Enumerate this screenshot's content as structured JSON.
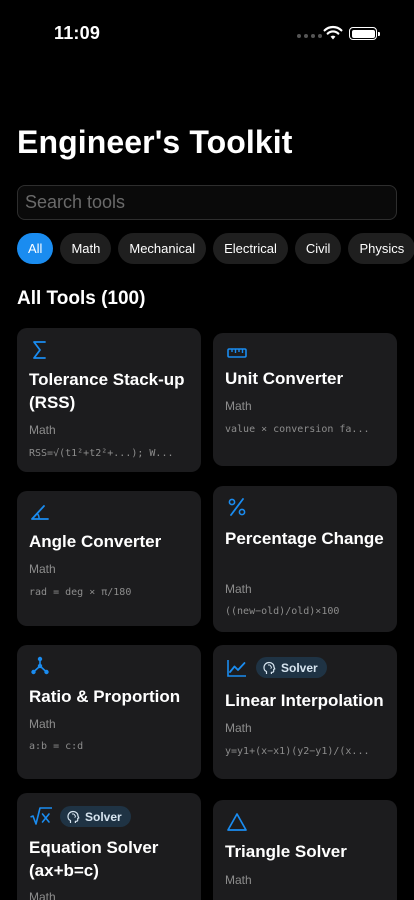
{
  "status_bar": {
    "time": "11:09"
  },
  "header": {
    "title": "Engineer's Toolkit"
  },
  "search": {
    "placeholder": "Search tools"
  },
  "filters": [
    "All",
    "Math",
    "Mechanical",
    "Electrical",
    "Civil",
    "Physics"
  ],
  "active_filter": "All",
  "section": {
    "title": "All Tools (100)"
  },
  "tools": [
    {
      "icon": "sigma-icon",
      "title": "Tolerance Stack-up (RSS)",
      "category": "Math",
      "formula": "RSS=√(t1²+t2²+...); W..."
    },
    {
      "icon": "ruler-icon",
      "title": "Unit Converter",
      "category": "Math",
      "formula": "value × conversion fa..."
    },
    {
      "icon": "angle-icon",
      "title": "Angle Converter",
      "category": "Math",
      "formula": "rad = deg × π/180"
    },
    {
      "icon": "percent-icon",
      "title": "Percentage Change",
      "category": "Math",
      "formula": "((new−old)/old)×100"
    },
    {
      "icon": "nodes-icon",
      "title": "Ratio & Proportion",
      "category": "Math",
      "formula": "a:b = c:d"
    },
    {
      "icon": "chart-line-icon",
      "title": "Linear Interpolation",
      "category": "Math",
      "formula": "y=y1+(x−x1)(y2−y1)/(x...",
      "badge": "Solver"
    },
    {
      "icon": "sqrt-icon",
      "title": "Equation Solver (ax+b=c)",
      "category": "Math",
      "formula": "",
      "badge": "Solver"
    },
    {
      "icon": "triangle-icon",
      "title": "Triangle Solver",
      "category": "Math",
      "formula": ""
    }
  ],
  "colors": {
    "accent": "#1a8cf0",
    "card": "#1c1c1e",
    "chip": "#1f1f1f",
    "badge_bg": "#1f3344",
    "muted_text": "#8d8d8d"
  }
}
